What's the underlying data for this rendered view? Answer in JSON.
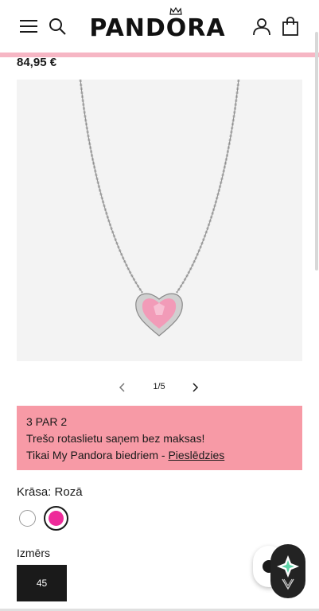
{
  "header": {
    "logo_text": "PANDORA",
    "icons": [
      "menu-icon",
      "search-icon",
      "account-icon",
      "bag-icon"
    ]
  },
  "product": {
    "price": "84,95 €"
  },
  "gallery": {
    "pager_text": "1/5"
  },
  "promo": {
    "title": "3 PAR 2",
    "line1": "Trešo rotaslietu saņem bez maksas!",
    "line2_prefix": "Tikai My Pandora biedriem - ",
    "link_label": "Pieslēdzies",
    "background": "#f79aa6"
  },
  "color": {
    "label": "Krāsa: Rozā",
    "swatches": [
      {
        "name": "white",
        "hex": "#ffffff",
        "selected": false
      },
      {
        "name": "pink",
        "hex": "#ee2b9a",
        "selected": true
      }
    ]
  },
  "size": {
    "label": "Izmērs",
    "options": [
      {
        "value": "45",
        "selected": true
      }
    ]
  },
  "colors": {
    "accent_pink": "#f6b6c4",
    "text": "#1a1a1a"
  }
}
